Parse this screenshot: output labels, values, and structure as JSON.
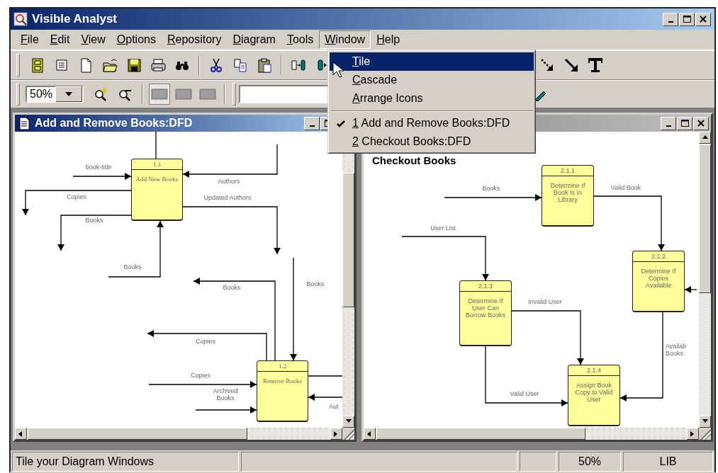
{
  "window": {
    "title": "Visible Analyst"
  },
  "menu_bar": [
    {
      "label": "File",
      "selected": false
    },
    {
      "label": "Edit",
      "selected": false
    },
    {
      "label": "View",
      "selected": false
    },
    {
      "label": "Options",
      "selected": false
    },
    {
      "label": "Repository",
      "selected": false
    },
    {
      "label": "Diagram",
      "selected": false
    },
    {
      "label": "Tools",
      "selected": false
    },
    {
      "label": "Window",
      "selected": true
    },
    {
      "label": "Help",
      "selected": false
    }
  ],
  "toolbar": {
    "zoom_value": "50%"
  },
  "window_menu": {
    "sections": [
      {
        "items": [
          {
            "label": "Tile",
            "selected": true,
            "checked": false
          },
          {
            "label": "Cascade",
            "selected": false,
            "checked": false
          },
          {
            "label": "Arrange Icons",
            "selected": false,
            "checked": false
          }
        ]
      },
      {
        "items": [
          {
            "label": "1 Add and Remove Books:DFD",
            "selected": false,
            "checked": true
          },
          {
            "label": "2 Checkout Books:DFD",
            "selected": false,
            "checked": false
          }
        ]
      }
    ]
  },
  "documents": [
    {
      "title": "Add and Remove Books:DFD",
      "active": true,
      "diagram": {
        "processes": [
          {
            "number": "1.1",
            "label": "Add New Books"
          },
          {
            "number": "1.2",
            "label": "Remove Books"
          }
        ],
        "flows": [
          {
            "label": "book-title"
          },
          {
            "label": "Authors"
          },
          {
            "label": "Copies"
          },
          {
            "label": "Books"
          },
          {
            "label": "Updated Authors"
          },
          {
            "label": "Books"
          },
          {
            "label": "Books"
          },
          {
            "label": "Books"
          },
          {
            "label": "Copies"
          },
          {
            "label": "Copies"
          },
          {
            "label": "Archived Books"
          },
          {
            "label": "Aut"
          }
        ]
      }
    },
    {
      "active": false,
      "diagram": {
        "heading": "Checkout Books",
        "processes": [
          {
            "number": "2.1.1",
            "label": "Determine If Book Is In Library"
          },
          {
            "number": "2.1.2",
            "label": "Determine If Copies Available"
          },
          {
            "number": "2.1.3",
            "label": "Determine If User Can Borrow Books"
          },
          {
            "number": "2.1.4",
            "label": "Assign Book Copy to Valid User"
          }
        ],
        "flows": [
          {
            "label": "Books"
          },
          {
            "label": "Valid Book"
          },
          {
            "label": "User List"
          },
          {
            "label": "Invalid User"
          },
          {
            "label": "Valid User"
          },
          {
            "label": "Availab Books"
          }
        ]
      }
    }
  ],
  "status_bar": {
    "message": "Tile your Diagram Windows",
    "zoom": "50%",
    "mode": "LIB"
  }
}
